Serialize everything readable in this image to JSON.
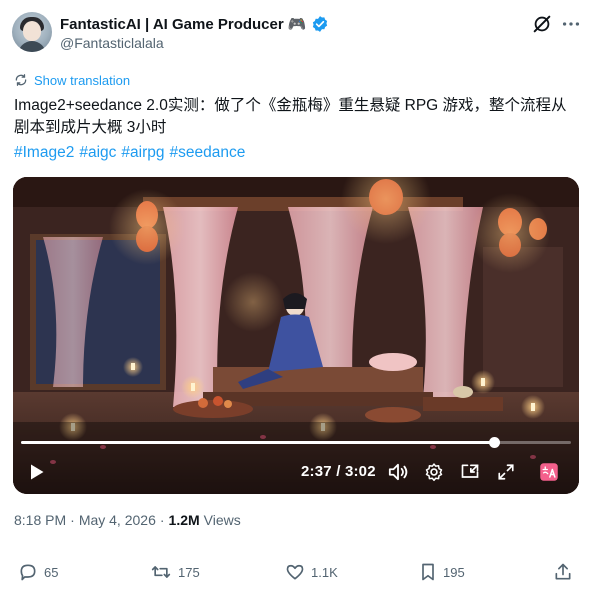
{
  "author": {
    "display_name": "FantasticAI | AI Game Producer 🎮",
    "handle": "@Fantasticlalala",
    "verified_color": "#1d9bf0",
    "icons": [
      "verified-badge-icon",
      "grok-icon",
      "more-icon"
    ]
  },
  "translation": {
    "label": "Show translation",
    "icon": "translate-icon"
  },
  "tweet": {
    "text": "Image2+seedance 2.0实测：做了个《金瓶梅》重生悬疑 RPG 游戏，整个流程从剧本到成片大概 3小时",
    "hashtags": [
      "#Image2",
      "#aigc",
      "#airpg",
      "#seedance"
    ]
  },
  "video": {
    "current_time": "2:37",
    "separator": " / ",
    "duration": "3:02",
    "progress": 0.86,
    "controls": [
      "play-icon",
      "volume-icon",
      "settings-icon",
      "picture-in-picture-icon",
      "fullscreen-icon",
      "captions-icon"
    ]
  },
  "meta": {
    "time": "8:18 PM",
    "separator": "·",
    "date": "May 4, 2026",
    "views_count": "1.2M",
    "views_label": "Views"
  },
  "actions": {
    "replies": "65",
    "reposts": "175",
    "likes": "1.1K",
    "bookmarks": "195"
  },
  "colors": {
    "text": "#0f1419",
    "secondary": "#536471",
    "link": "#1d9bf0",
    "captions_badge": "#f4608c"
  }
}
